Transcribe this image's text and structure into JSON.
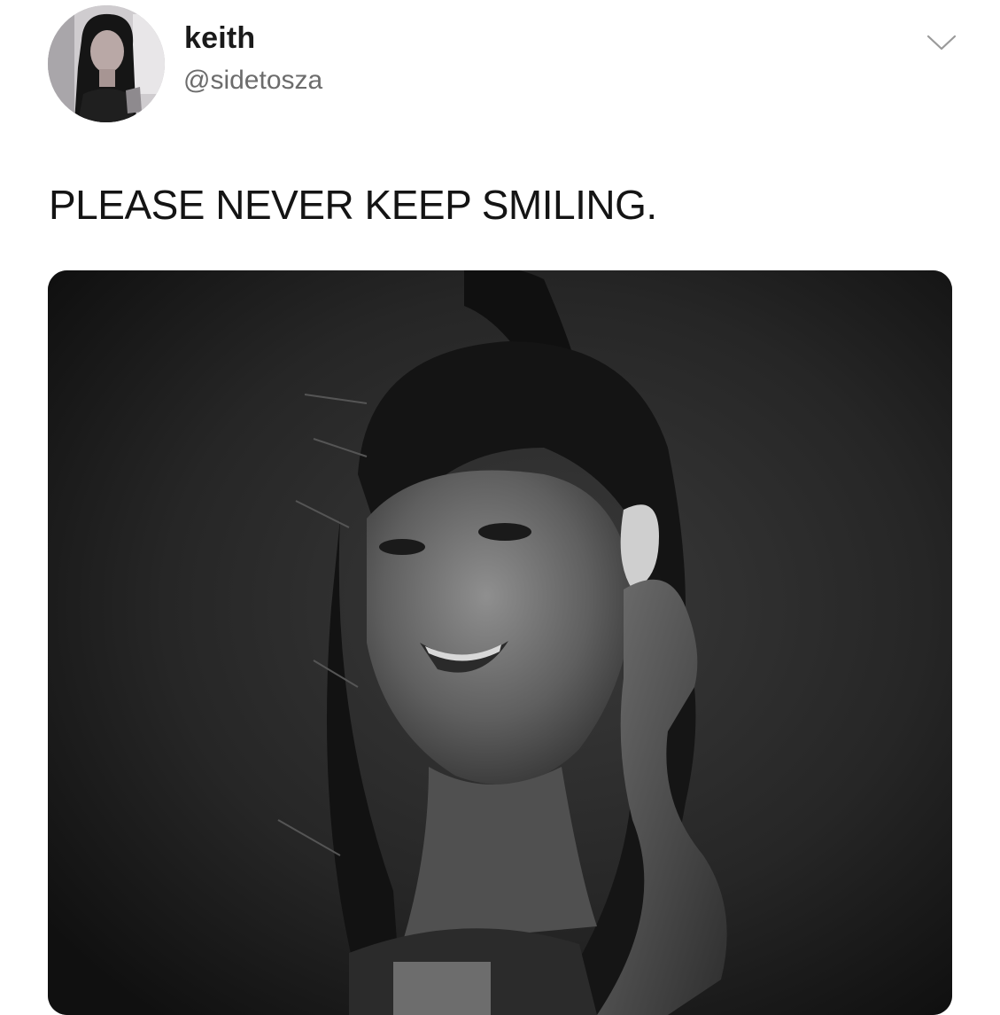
{
  "tweet": {
    "display_name": "keith",
    "handle": "@sidetosza",
    "text": "PLEASE NEVER KEEP SMILING.",
    "menu_icon": "chevron-down-icon",
    "avatar_icon": "profile-photo",
    "media_icon": "black-and-white-photo"
  },
  "colors": {
    "name": "#1a1a1a",
    "handle": "#6c6c6c",
    "text": "#141414",
    "chevron": "#9a9a9a"
  }
}
